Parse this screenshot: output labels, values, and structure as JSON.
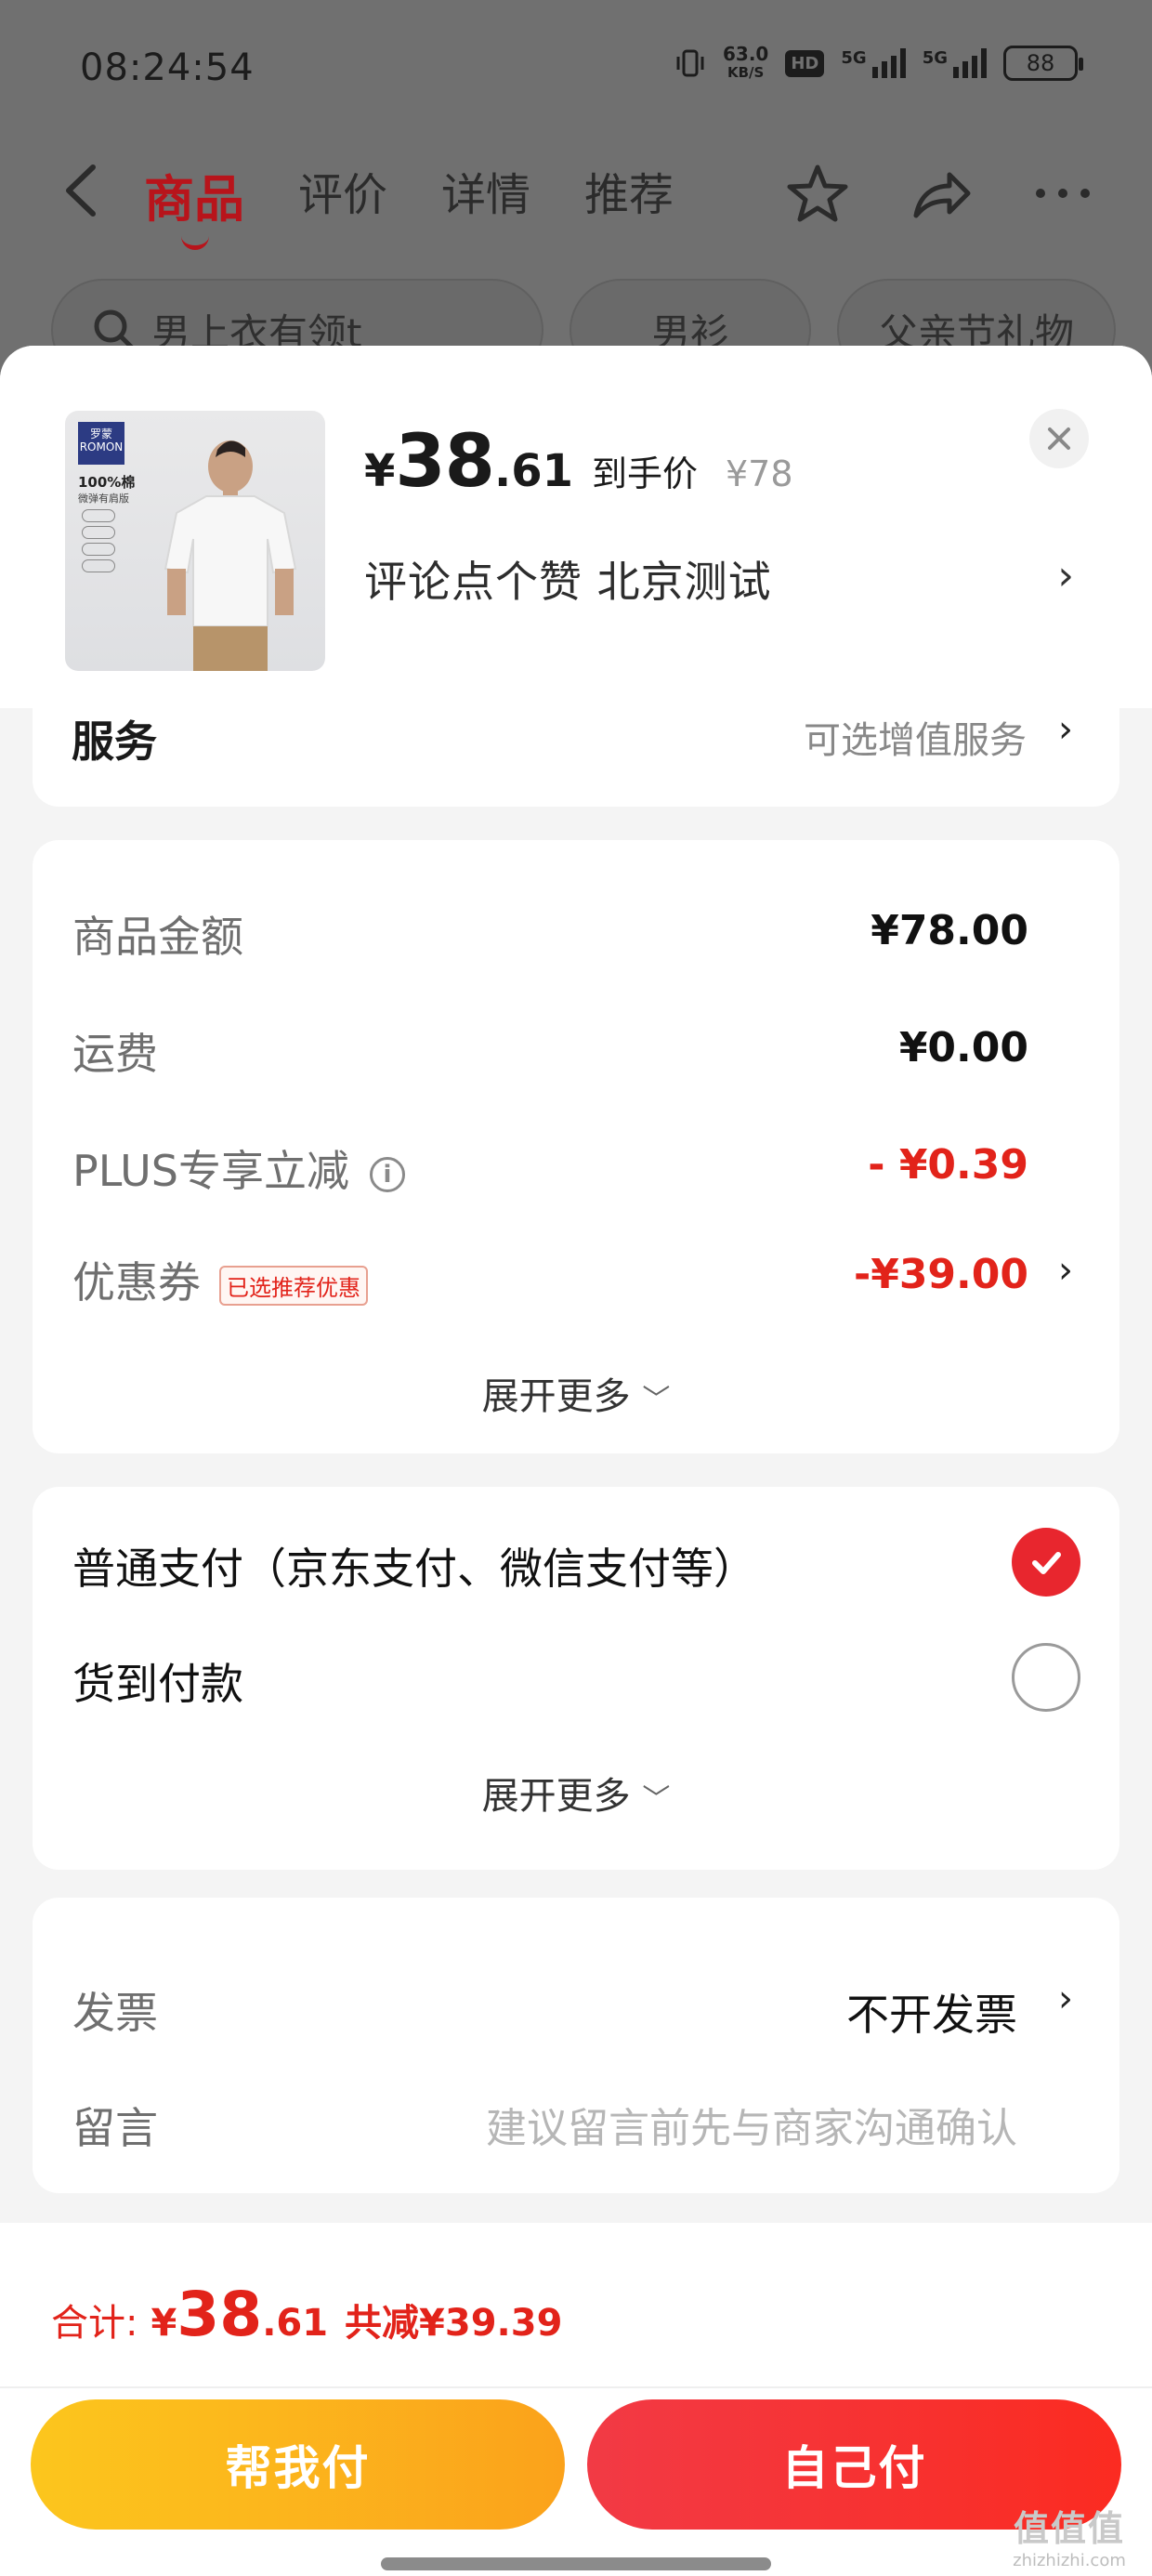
{
  "status_bar": {
    "time": "08:24:54",
    "net_speed_value": "63.0",
    "net_speed_unit": "KB/S",
    "hd_badge": "HD",
    "signal1_label": "5G",
    "signal2_label": "5G",
    "battery": "88"
  },
  "nav": {
    "tabs": [
      {
        "label": "商品",
        "active": true
      },
      {
        "label": "评价",
        "active": false
      },
      {
        "label": "详情",
        "active": false
      },
      {
        "label": "推荐",
        "active": false
      }
    ]
  },
  "search_row": {
    "search_text": "男上衣有领t",
    "chip1": "男衫",
    "chip2": "父亲节礼物"
  },
  "product": {
    "image_brand": "罗蒙 ROMON",
    "image_cotton": "100%棉",
    "image_sub": "微弹有肩版",
    "price_yen": "¥",
    "price_int": "38",
    "price_dec": ".61",
    "price_tag": "到手价",
    "price_original": "¥78",
    "promo_text": "评论点个赞  北京测试"
  },
  "service": {
    "title": "服务",
    "value": "可选增值服务"
  },
  "amounts": {
    "rows": [
      {
        "label": "商品金额",
        "value": "¥78.00",
        "red": false
      },
      {
        "label": "运费",
        "value": "¥0.00",
        "red": false
      },
      {
        "label": "PLUS专享立减",
        "value": "- ¥0.39",
        "red": true
      },
      {
        "label": "优惠券",
        "badge": "已选推荐优惠",
        "value": "-¥39.00",
        "red": true
      }
    ],
    "expand_label": "展开更多"
  },
  "payment": {
    "options": [
      {
        "label": "普通支付（京东支付、微信支付等）",
        "selected": true
      },
      {
        "label": "货到付款",
        "selected": false
      }
    ],
    "expand_label": "展开更多"
  },
  "invoice": {
    "invoice_label": "发票",
    "invoice_value": "不开发票",
    "note_label": "留言",
    "note_placeholder": "建议留言前先与商家沟通确认"
  },
  "footer": {
    "total_label": "合计:",
    "total_yen": "¥",
    "total_int": "38",
    "total_dec": ".61",
    "total_save": "共减¥39.39",
    "btn_help": "帮我付",
    "btn_self": "自己付"
  },
  "watermark": {
    "logo": "值值值",
    "site": "zhizhizhi.com"
  },
  "colors": {
    "accent_red": "#e2231a",
    "nav_active": "#b8141b",
    "btn_help_yellow": "#fcc61d",
    "btn_self_red": "#f23a45"
  }
}
